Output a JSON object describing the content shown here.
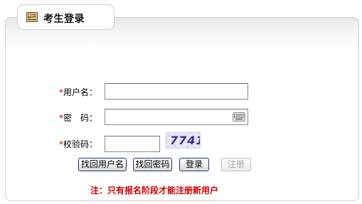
{
  "header": {
    "title": "考生登录",
    "icon": "id-card-icon"
  },
  "form": {
    "username": {
      "required_mark": "*",
      "label": "用户名：",
      "value": ""
    },
    "password": {
      "required_mark": "*",
      "label": "密　码：",
      "value": "",
      "icon": "keyboard-icon"
    },
    "captcha": {
      "required_mark": "*",
      "label": "校验码：",
      "value": "",
      "image_text": "7741"
    }
  },
  "buttons": {
    "find_username": "找回用户名",
    "find_password": "找回密码",
    "login": "登录",
    "register": "注册"
  },
  "notice": "注：只有报名阶段才能注册新用户",
  "colors": {
    "required": "#cc0000",
    "notice": "#cc0000",
    "button_border": "#1d3b6e"
  }
}
